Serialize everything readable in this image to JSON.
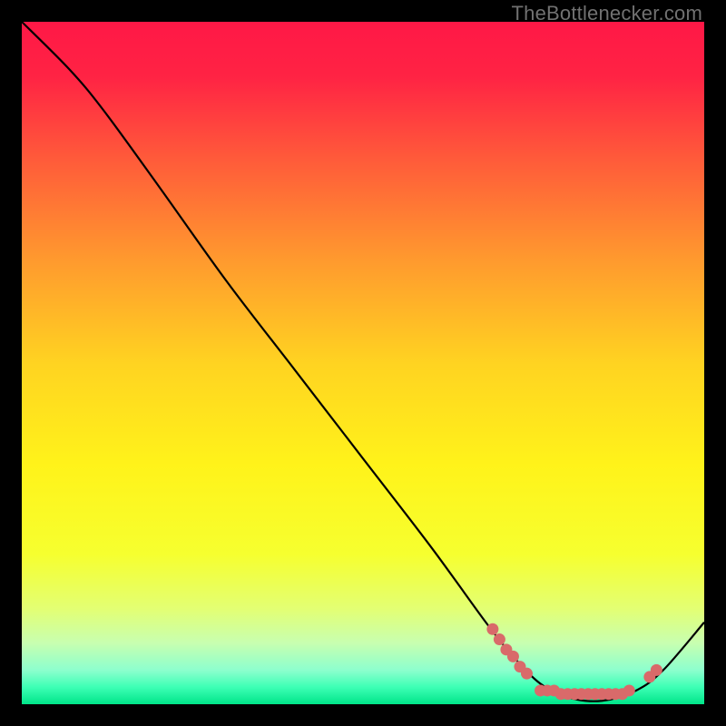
{
  "attribution": "TheBottlenecker.com",
  "chart_data": {
    "type": "line",
    "title": "",
    "xlabel": "",
    "ylabel": "",
    "xlim": [
      0,
      100
    ],
    "ylim": [
      0,
      100
    ],
    "curve": [
      {
        "x": 0,
        "y": 100
      },
      {
        "x": 7,
        "y": 93
      },
      {
        "x": 12,
        "y": 87
      },
      {
        "x": 20,
        "y": 76
      },
      {
        "x": 30,
        "y": 62
      },
      {
        "x": 40,
        "y": 49
      },
      {
        "x": 50,
        "y": 36
      },
      {
        "x": 60,
        "y": 23
      },
      {
        "x": 68,
        "y": 12
      },
      {
        "x": 72,
        "y": 7
      },
      {
        "x": 76,
        "y": 3
      },
      {
        "x": 80,
        "y": 1
      },
      {
        "x": 85,
        "y": 0.5
      },
      {
        "x": 90,
        "y": 2
      },
      {
        "x": 94,
        "y": 5
      },
      {
        "x": 100,
        "y": 12
      }
    ],
    "markers": [
      {
        "x": 69,
        "y": 11
      },
      {
        "x": 70,
        "y": 9.5
      },
      {
        "x": 71,
        "y": 8
      },
      {
        "x": 72,
        "y": 7
      },
      {
        "x": 73,
        "y": 5.5
      },
      {
        "x": 74,
        "y": 4.5
      },
      {
        "x": 76,
        "y": 2
      },
      {
        "x": 77,
        "y": 2
      },
      {
        "x": 78,
        "y": 2
      },
      {
        "x": 79,
        "y": 1.5
      },
      {
        "x": 80,
        "y": 1.5
      },
      {
        "x": 81,
        "y": 1.5
      },
      {
        "x": 82,
        "y": 1.5
      },
      {
        "x": 83,
        "y": 1.5
      },
      {
        "x": 84,
        "y": 1.5
      },
      {
        "x": 85,
        "y": 1.5
      },
      {
        "x": 86,
        "y": 1.5
      },
      {
        "x": 87,
        "y": 1.5
      },
      {
        "x": 88,
        "y": 1.5
      },
      {
        "x": 89,
        "y": 2
      },
      {
        "x": 92,
        "y": 4
      },
      {
        "x": 93,
        "y": 5
      }
    ],
    "gradient_stops": [
      {
        "offset": 0,
        "color": "#ff1846"
      },
      {
        "offset": 0.08,
        "color": "#ff2344"
      },
      {
        "offset": 0.2,
        "color": "#ff5a3a"
      },
      {
        "offset": 0.35,
        "color": "#ff9a2e"
      },
      {
        "offset": 0.5,
        "color": "#ffd321"
      },
      {
        "offset": 0.65,
        "color": "#fff31a"
      },
      {
        "offset": 0.78,
        "color": "#f6ff2f"
      },
      {
        "offset": 0.86,
        "color": "#e3ff73"
      },
      {
        "offset": 0.91,
        "color": "#c8ffb0"
      },
      {
        "offset": 0.95,
        "color": "#8dffce"
      },
      {
        "offset": 0.975,
        "color": "#3dffb5"
      },
      {
        "offset": 1.0,
        "color": "#00e589"
      }
    ],
    "marker_color": "#d96a6a",
    "line_color": "#000000"
  }
}
